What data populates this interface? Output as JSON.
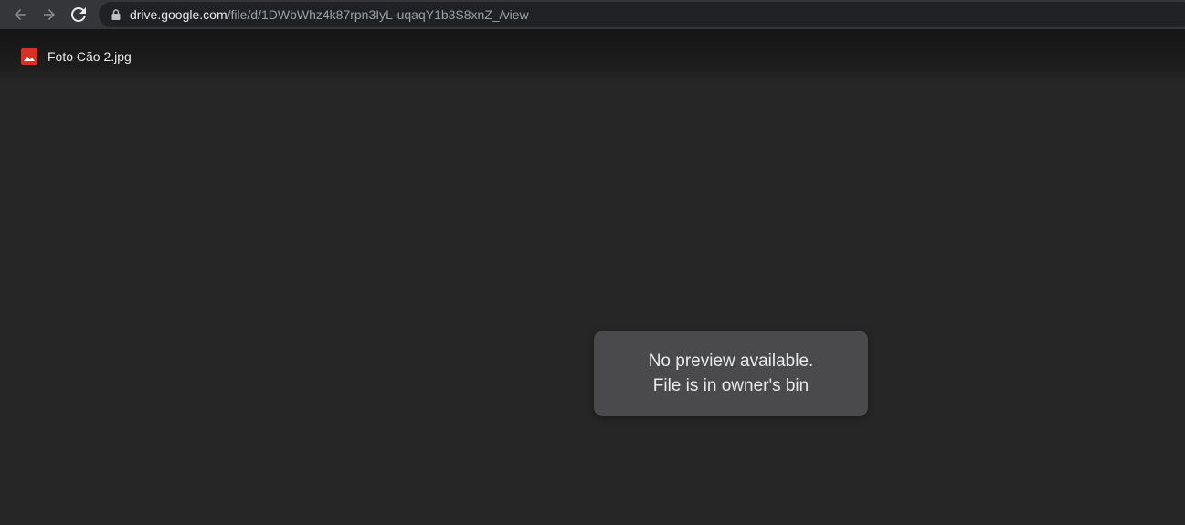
{
  "browser": {
    "url_host": "drive.google.com",
    "url_path": "/file/d/1DWbWhz4k87rpn3IyL-uqaqY1b3S8xnZ_/view",
    "icons": {
      "back": "arrow-left-icon",
      "forward": "arrow-right-icon",
      "reload": "reload-icon",
      "lock": "lock-icon"
    }
  },
  "viewer": {
    "file_name": "Foto Cão 2.jpg",
    "file_icon": "image-file-icon",
    "file_icon_color": "#d93025",
    "message": {
      "line1": "No preview available.",
      "line2": "File is in owner's bin"
    }
  },
  "colors": {
    "toolbar_bg": "#35363a",
    "omnibox_bg": "#202124",
    "viewer_bg": "#262626",
    "card_bg": "#4a4a4c",
    "text_primary": "#e8eaed",
    "text_secondary": "#9aa0a6"
  }
}
